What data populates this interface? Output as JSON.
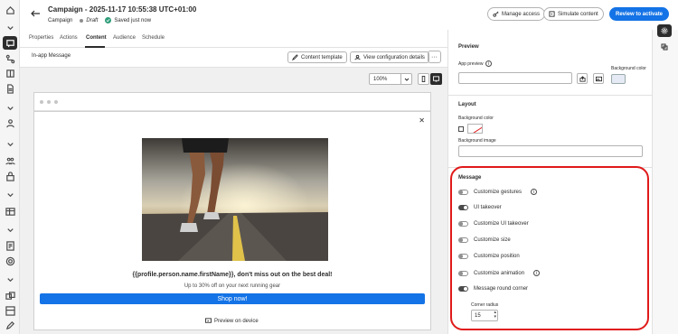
{
  "header": {
    "title": "Campaign - 2025-11-17 10:55:38 UTC+01:00",
    "type": "Campaign",
    "status": "Draft",
    "saved": "Saved just now",
    "manage_access": "Manage access",
    "simulate": "Simulate content",
    "review": "Review to activate"
  },
  "tabs": [
    "Properties",
    "Actions",
    "Content",
    "Audience",
    "Schedule"
  ],
  "toolbar": {
    "label": "In-app Message",
    "content_template": "Content template",
    "view_config": "View configuration details",
    "more": "···"
  },
  "canvas": {
    "zoom": "100%",
    "close": "✕",
    "headline": "{{profile.person.name.firstName}}, don't miss out on the best deal!",
    "body": "Up to 30% off on your next running gear",
    "cta": "Shop now!",
    "preview_device": "Preview on device"
  },
  "props": {
    "preview_title": "Preview",
    "app_preview": "App preview",
    "background_color": "Background color",
    "layout_title": "Layout",
    "layout_bg_color": "Background color",
    "background_image": "Background image",
    "message_title": "Message",
    "toggles": [
      {
        "label": "Customize gestures",
        "on": false,
        "info": true
      },
      {
        "label": "UI takeover",
        "on": true,
        "info": false
      },
      {
        "label": "Customize UI takeover",
        "on": false,
        "info": false
      },
      {
        "label": "Customize size",
        "on": false,
        "info": false
      },
      {
        "label": "Customize position",
        "on": false,
        "info": false
      },
      {
        "label": "Customize animation",
        "on": false,
        "info": true
      },
      {
        "label": "Message round corner",
        "on": true,
        "info": false
      }
    ],
    "corner_radius_label": "Corner radius",
    "corner_radius": "15"
  },
  "colors": {
    "accent": "#1473e6",
    "highlight": "#e01a1a"
  }
}
